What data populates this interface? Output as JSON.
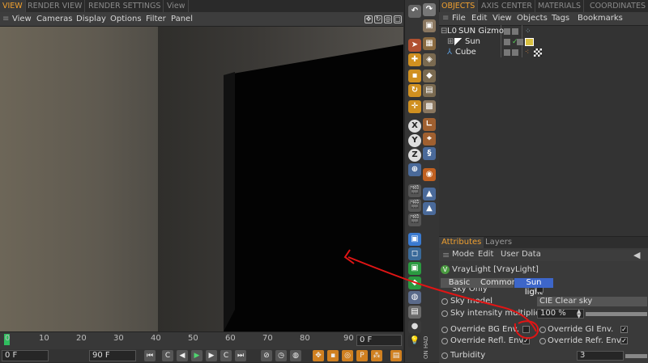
{
  "top_tabs": {
    "view": "VIEW",
    "render_view": "RENDER VIEW",
    "render_settings": "RENDER SETTINGS",
    "view2": "View",
    "objects": "OBJECTS",
    "axis_center": "AXIS CENTER",
    "materials": "MATERIALS",
    "coordinates": "COORDINATES"
  },
  "viewport_menu": [
    "View",
    "Cameras",
    "Display",
    "Options",
    "Filter",
    "Panel"
  ],
  "objects_menu": [
    "File",
    "Edit",
    "View",
    "Objects",
    "Tags",
    "Bookmarks"
  ],
  "objects": [
    {
      "name": "SUN Gizmo"
    },
    {
      "name": "Sun"
    },
    {
      "name": "Cube"
    }
  ],
  "timeline": {
    "ticks": [
      "0",
      "10",
      "20",
      "30",
      "40",
      "50",
      "60",
      "70",
      "80",
      "90"
    ],
    "current_frame": "0 F",
    "start_frame": "0 F",
    "end_frame": "90 F"
  },
  "attributes": {
    "tabs": {
      "attributes": "Attributes",
      "layers": "Layers"
    },
    "menu": [
      "Mode",
      "Edit",
      "User Data"
    ],
    "object_title": "VrayLight [VrayLight]",
    "sub_tabs": {
      "basic": "Basic",
      "common": "Common",
      "sun_light": "Sun light"
    },
    "rows": {
      "sky_only": "Sky Only",
      "sky_model_label": "Sky model",
      "sky_model_value": "CIE Clear sky",
      "sky_intensity_label": "Sky intensity multiplier",
      "sky_intensity_value": "100 %",
      "override_bg": "Override BG Env.",
      "override_gi": "Override GI Env.",
      "override_refl": "Override Refl. Env.",
      "override_refr": "Override Refr. Env.",
      "turbidity_label": "Turbidity",
      "turbidity_value": "3"
    }
  },
  "side_label": "ON HAD",
  "annotation": {
    "color": "#e01515"
  },
  "colors": {
    "accent": "#f0a030",
    "selected": "#3d66c9"
  }
}
